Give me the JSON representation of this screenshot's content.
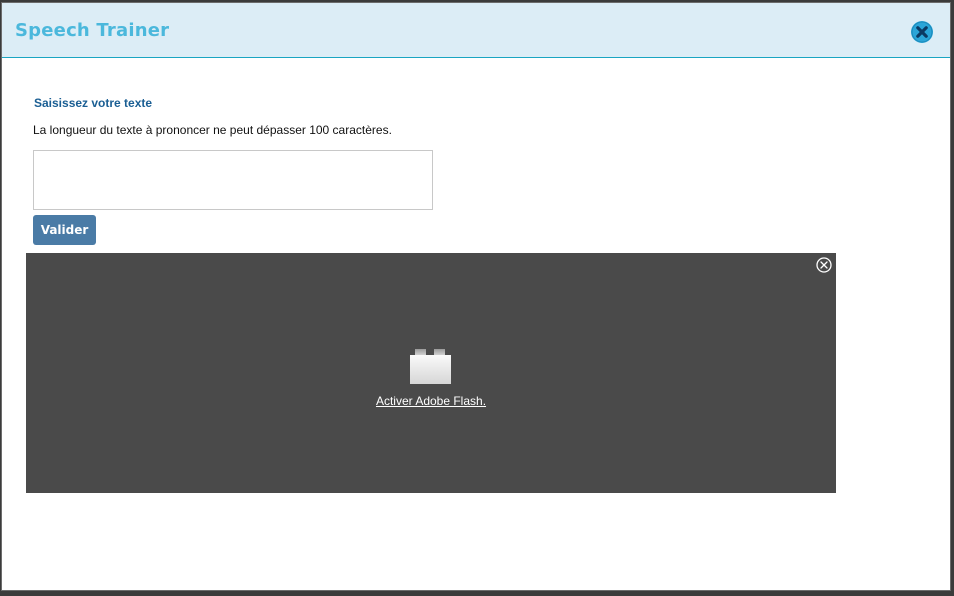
{
  "dialog": {
    "title": "Speech Trainer",
    "close_icon": "close-circle-icon",
    "header_color": "#dcedf6",
    "title_color": "#4bb8dc"
  },
  "form": {
    "section_title": "Saisissez votre texte",
    "help_text": "La longueur du texte à prononcer ne peut dépasser 100 caractères.",
    "text_value": "",
    "validate_label": "Valider",
    "button_color": "#4a7ba6"
  },
  "flash": {
    "activate_link": "Activer Adobe Flash.",
    "plugin_icon": "plugin-block-icon",
    "close_icon": "close-circle-icon",
    "panel_color": "#4a4a4a"
  }
}
